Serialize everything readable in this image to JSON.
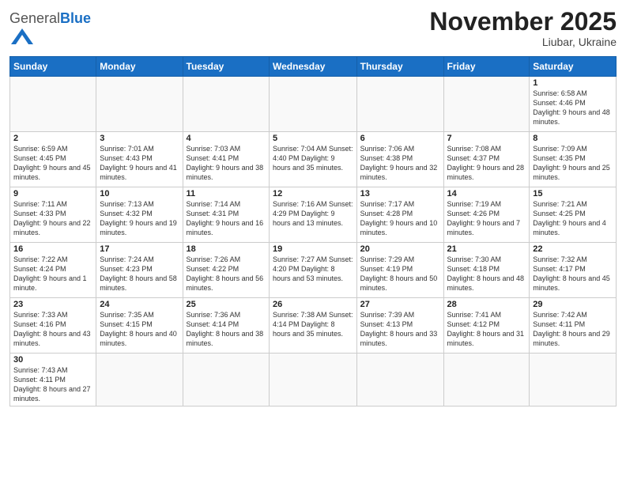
{
  "logo": {
    "general": "General",
    "blue": "Blue"
  },
  "title": "November 2025",
  "location": "Liubar, Ukraine",
  "headers": [
    "Sunday",
    "Monday",
    "Tuesday",
    "Wednesday",
    "Thursday",
    "Friday",
    "Saturday"
  ],
  "weeks": [
    [
      {
        "day": "",
        "info": ""
      },
      {
        "day": "",
        "info": ""
      },
      {
        "day": "",
        "info": ""
      },
      {
        "day": "",
        "info": ""
      },
      {
        "day": "",
        "info": ""
      },
      {
        "day": "",
        "info": ""
      },
      {
        "day": "1",
        "info": "Sunrise: 6:58 AM\nSunset: 4:46 PM\nDaylight: 9 hours and 48 minutes."
      }
    ],
    [
      {
        "day": "2",
        "info": "Sunrise: 6:59 AM\nSunset: 4:45 PM\nDaylight: 9 hours and 45 minutes."
      },
      {
        "day": "3",
        "info": "Sunrise: 7:01 AM\nSunset: 4:43 PM\nDaylight: 9 hours and 41 minutes."
      },
      {
        "day": "4",
        "info": "Sunrise: 7:03 AM\nSunset: 4:41 PM\nDaylight: 9 hours and 38 minutes."
      },
      {
        "day": "5",
        "info": "Sunrise: 7:04 AM\nSunset: 4:40 PM\nDaylight: 9 hours and 35 minutes."
      },
      {
        "day": "6",
        "info": "Sunrise: 7:06 AM\nSunset: 4:38 PM\nDaylight: 9 hours and 32 minutes."
      },
      {
        "day": "7",
        "info": "Sunrise: 7:08 AM\nSunset: 4:37 PM\nDaylight: 9 hours and 28 minutes."
      },
      {
        "day": "8",
        "info": "Sunrise: 7:09 AM\nSunset: 4:35 PM\nDaylight: 9 hours and 25 minutes."
      }
    ],
    [
      {
        "day": "9",
        "info": "Sunrise: 7:11 AM\nSunset: 4:33 PM\nDaylight: 9 hours and 22 minutes."
      },
      {
        "day": "10",
        "info": "Sunrise: 7:13 AM\nSunset: 4:32 PM\nDaylight: 9 hours and 19 minutes."
      },
      {
        "day": "11",
        "info": "Sunrise: 7:14 AM\nSunset: 4:31 PM\nDaylight: 9 hours and 16 minutes."
      },
      {
        "day": "12",
        "info": "Sunrise: 7:16 AM\nSunset: 4:29 PM\nDaylight: 9 hours and 13 minutes."
      },
      {
        "day": "13",
        "info": "Sunrise: 7:17 AM\nSunset: 4:28 PM\nDaylight: 9 hours and 10 minutes."
      },
      {
        "day": "14",
        "info": "Sunrise: 7:19 AM\nSunset: 4:26 PM\nDaylight: 9 hours and 7 minutes."
      },
      {
        "day": "15",
        "info": "Sunrise: 7:21 AM\nSunset: 4:25 PM\nDaylight: 9 hours and 4 minutes."
      }
    ],
    [
      {
        "day": "16",
        "info": "Sunrise: 7:22 AM\nSunset: 4:24 PM\nDaylight: 9 hours and 1 minute."
      },
      {
        "day": "17",
        "info": "Sunrise: 7:24 AM\nSunset: 4:23 PM\nDaylight: 8 hours and 58 minutes."
      },
      {
        "day": "18",
        "info": "Sunrise: 7:26 AM\nSunset: 4:22 PM\nDaylight: 8 hours and 56 minutes."
      },
      {
        "day": "19",
        "info": "Sunrise: 7:27 AM\nSunset: 4:20 PM\nDaylight: 8 hours and 53 minutes."
      },
      {
        "day": "20",
        "info": "Sunrise: 7:29 AM\nSunset: 4:19 PM\nDaylight: 8 hours and 50 minutes."
      },
      {
        "day": "21",
        "info": "Sunrise: 7:30 AM\nSunset: 4:18 PM\nDaylight: 8 hours and 48 minutes."
      },
      {
        "day": "22",
        "info": "Sunrise: 7:32 AM\nSunset: 4:17 PM\nDaylight: 8 hours and 45 minutes."
      }
    ],
    [
      {
        "day": "23",
        "info": "Sunrise: 7:33 AM\nSunset: 4:16 PM\nDaylight: 8 hours and 43 minutes."
      },
      {
        "day": "24",
        "info": "Sunrise: 7:35 AM\nSunset: 4:15 PM\nDaylight: 8 hours and 40 minutes."
      },
      {
        "day": "25",
        "info": "Sunrise: 7:36 AM\nSunset: 4:14 PM\nDaylight: 8 hours and 38 minutes."
      },
      {
        "day": "26",
        "info": "Sunrise: 7:38 AM\nSunset: 4:14 PM\nDaylight: 8 hours and 35 minutes."
      },
      {
        "day": "27",
        "info": "Sunrise: 7:39 AM\nSunset: 4:13 PM\nDaylight: 8 hours and 33 minutes."
      },
      {
        "day": "28",
        "info": "Sunrise: 7:41 AM\nSunset: 4:12 PM\nDaylight: 8 hours and 31 minutes."
      },
      {
        "day": "29",
        "info": "Sunrise: 7:42 AM\nSunset: 4:11 PM\nDaylight: 8 hours and 29 minutes."
      }
    ],
    [
      {
        "day": "30",
        "info": "Sunrise: 7:43 AM\nSunset: 4:11 PM\nDaylight: 8 hours and 27 minutes."
      },
      {
        "day": "",
        "info": ""
      },
      {
        "day": "",
        "info": ""
      },
      {
        "day": "",
        "info": ""
      },
      {
        "day": "",
        "info": ""
      },
      {
        "day": "",
        "info": ""
      },
      {
        "day": "",
        "info": ""
      }
    ]
  ]
}
